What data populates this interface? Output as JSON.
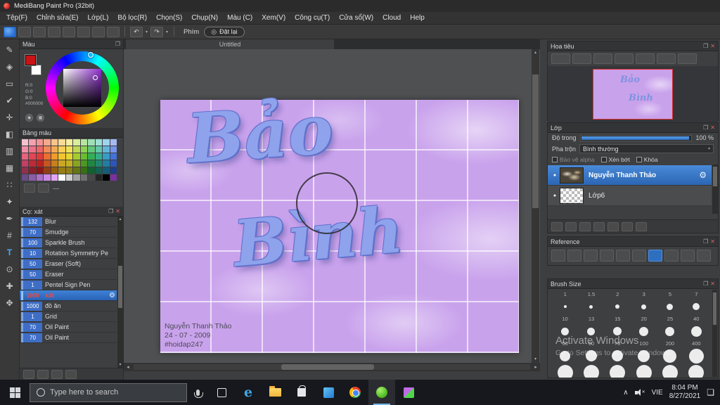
{
  "window": {
    "title": "MediBang Paint Pro (32bit)",
    "controls": [
      {
        "name": "minimize-button",
        "glyph": "–"
      },
      {
        "name": "maximize-button",
        "glyph": "▢"
      },
      {
        "name": "close-button",
        "glyph": "✕"
      }
    ]
  },
  "menu": {
    "items": [
      "Tệp(F)",
      "Chỉnh sửa(E)",
      "Lớp(L)",
      "Bộ lọc(R)",
      "Chọn(S)",
      "Chụp(N)",
      "Màu (C)",
      "Xem(V)",
      "Công cụ(T)",
      "Cửa sổ(W)",
      "Cloud",
      "Help"
    ]
  },
  "toolbar": {
    "icons": [
      {
        "name": "paint-tool-logo-icon",
        "glyph": "◉"
      },
      {
        "name": "save-icon",
        "glyph": "▤"
      },
      {
        "name": "comment-icon",
        "glyph": "❏"
      },
      {
        "name": "new-doc-icon",
        "glyph": "▢"
      },
      {
        "name": "copy-doc-icon",
        "glyph": "⊡"
      },
      {
        "name": "grid-view-icon",
        "glyph": "▦"
      },
      {
        "name": "panel-grid-icon",
        "glyph": "▥"
      },
      {
        "name": "layout-icon",
        "glyph": "☰"
      }
    ],
    "undo_glyph": "↶",
    "redo_glyph": "↷",
    "caret_glyph": "▾",
    "phim_label": "Phím",
    "reset_icon_glyph": "◎",
    "reset_label": "Đặt lại"
  },
  "chrome": {
    "float": "❐",
    "close": "✕",
    "up": "▴",
    "down": "▾",
    "left": "◂",
    "right": "▸"
  },
  "tools": {
    "items": [
      {
        "name": "brush-tool",
        "glyph": "✎"
      },
      {
        "name": "eraser-tool",
        "glyph": "◈"
      },
      {
        "name": "select-rect-tool",
        "glyph": "▭"
      },
      {
        "name": "select-pen-tool",
        "glyph": "✔"
      },
      {
        "name": "move-tool",
        "glyph": "✛"
      },
      {
        "name": "bucket-tool",
        "glyph": "◧"
      },
      {
        "name": "gradient-tool",
        "glyph": "▥"
      },
      {
        "name": "pattern-tool",
        "glyph": "▦"
      },
      {
        "name": "halftone-tool",
        "glyph": "∷"
      },
      {
        "name": "magic-wand-tool",
        "glyph": "✦"
      },
      {
        "name": "eyedropper-tool",
        "glyph": "✒"
      },
      {
        "name": "divide-tool",
        "glyph": "#"
      },
      {
        "name": "text-tool",
        "glyph": "T",
        "selected": true
      },
      {
        "name": "zoom-tool",
        "glyph": "⊙"
      },
      {
        "name": "measure-tool",
        "glyph": "✚"
      },
      {
        "name": "hand-tool",
        "glyph": "✥"
      }
    ]
  },
  "color_panel": {
    "title": "Màu",
    "rgb_lines": [
      "R:0",
      "G:0",
      "B:0",
      "#000000"
    ],
    "palette_title": "Bảng màu",
    "palette_placeholder": "---",
    "palette": [
      "#f6c2cc",
      "#f2a2b0",
      "#f29494",
      "#f4aa8a",
      "#f8c48c",
      "#fada96",
      "#f4ee9e",
      "#d8ee9c",
      "#b6e69e",
      "#9ee0b6",
      "#9ee0d6",
      "#9ed4ee",
      "#a6baf2",
      "#ee8ea6",
      "#ec7288",
      "#ec6666",
      "#f08c5a",
      "#f4aa54",
      "#f8ce56",
      "#f0e056",
      "#bed856",
      "#8ed056",
      "#64c67c",
      "#64c6aa",
      "#64b4da",
      "#7694ea",
      "#e6627e",
      "#e24656",
      "#e23a3a",
      "#e87032",
      "#ee9c2a",
      "#f2c42e",
      "#e6d62e",
      "#a4cc2e",
      "#68be2e",
      "#34ae56",
      "#34ae8a",
      "#349ec6",
      "#4272da",
      "#c24064",
      "#be2a3a",
      "#be2020",
      "#c45620",
      "#c8801c",
      "#cca620",
      "#c4b020",
      "#88a420",
      "#4c9820",
      "#208644",
      "#208670",
      "#207ea4",
      "#2e54b6",
      "#90304c",
      "#8c1e2a",
      "#8c1616",
      "#903e14",
      "#945e12",
      "#987c14",
      "#908014",
      "#647614",
      "#386e14",
      "#146032",
      "#146052",
      "#145c78",
      "#203c86",
      "#6a4c88",
      "#8c5ca8",
      "#ac70c8",
      "#ca88e4",
      "#e2a4f4",
      "#ffffff",
      "#d0d0d0",
      "#a0a0a0",
      "#707070",
      "#484848",
      "#242424",
      "#000000",
      "#7c30a2"
    ],
    "palette_tools": [
      {
        "name": "add-color-icon",
        "glyph": "⊞"
      },
      {
        "name": "delete-color-icon",
        "glyph": "⊟"
      }
    ]
  },
  "brush_panel": {
    "title": "Cọ: xát",
    "brushes": [
      {
        "size": "132",
        "name": "Blur"
      },
      {
        "size": "70",
        "name": "Smudge"
      },
      {
        "size": "100",
        "name": "Sparkle Brush"
      },
      {
        "size": "10",
        "name": "Rotation Symmetry Pe"
      },
      {
        "size": "50",
        "name": "Eraser (Soft)"
      },
      {
        "size": "50",
        "name": "Eraser"
      },
      {
        "size": "1",
        "name": "Pentel Sign Pen"
      },
      {
        "size": "1000",
        "name": "xát",
        "selected": true
      },
      {
        "size": "1000",
        "name": "đồ ăn"
      },
      {
        "size": "1",
        "name": "Grid"
      },
      {
        "size": "70",
        "name": "Oil Paint"
      },
      {
        "size": "70",
        "name": "Oil Paint"
      }
    ],
    "gear_glyph": "⚙",
    "tools": [
      {
        "name": "new-brush-icon",
        "glyph": "⊞"
      },
      {
        "name": "delete-brush-icon",
        "glyph": "⊟"
      },
      {
        "name": "brush-folder-icon",
        "glyph": "▤"
      },
      {
        "name": "brush-menu-icon",
        "glyph": "⊡"
      }
    ]
  },
  "canvas": {
    "tab": "Untitled",
    "word1": "Bảo",
    "word2": "Bình",
    "credits": [
      "Nguyễn Thanh Thảo",
      "24 - 07 - 2009",
      "#hoidap247"
    ]
  },
  "navigator": {
    "title": "Hoa tiêu",
    "icons": [
      {
        "name": "zoom-out-icon",
        "glyph": "⊖"
      },
      {
        "name": "zoom-in-icon",
        "glyph": "⊕"
      },
      {
        "name": "fit-window-icon",
        "glyph": "▢"
      },
      {
        "name": "actual-pixels-icon",
        "glyph": "▣"
      },
      {
        "name": "rotate-left-icon",
        "glyph": "↺"
      },
      {
        "name": "rotate-right-icon",
        "glyph": "↻"
      },
      {
        "name": "reset-rotation-icon",
        "glyph": "◎"
      }
    ]
  },
  "layer_panel": {
    "title": "Lớp",
    "opacity_label": "Độ trong",
    "opacity_value": "100 %",
    "blend_label": "Pha trộn",
    "blend_value": "Bình thường",
    "checkboxes": [
      {
        "label": "Bảo vệ alpha",
        "disabled": true
      },
      {
        "label": "Xén bớt"
      },
      {
        "label": "Khóa"
      }
    ],
    "layers": [
      {
        "name": "Nguyễn Thanh Thảo",
        "selected": true,
        "thumb": "art"
      },
      {
        "name": "Lớp6",
        "thumb": "checker"
      }
    ],
    "gear_glyph": "⚙",
    "eye_glyph": "●",
    "toolbar_icons": [
      {
        "name": "new-layer-icon",
        "glyph": "⊞"
      },
      {
        "name": "duplicate-layer-icon",
        "glyph": "⊡"
      },
      {
        "name": "transfer-layer-icon",
        "glyph": "▼"
      },
      {
        "name": "layer-folder-icon",
        "glyph": "▤"
      },
      {
        "name": "layer-order-icon",
        "glyph": "↕"
      },
      {
        "name": "layer-menu-icon",
        "glyph": "≡"
      },
      {
        "name": "delete-layer-icon",
        "glyph": "⊠"
      }
    ]
  },
  "reference_panel": {
    "title": "Reference",
    "icons": [
      {
        "name": "home-icon",
        "glyph": "⌂"
      },
      {
        "name": "image-icon",
        "glyph": "▦"
      },
      {
        "name": "clear-icon",
        "glyph": "✕"
      },
      {
        "name": "zoom-in-icon",
        "glyph": "⊕"
      },
      {
        "name": "zoom-out-icon",
        "glyph": "⊖"
      },
      {
        "name": "pencil-icon",
        "glyph": "✎"
      },
      {
        "name": "hand-icon",
        "glyph": "✥",
        "selected": true
      },
      {
        "name": "eyedropper-icon",
        "glyph": "✒"
      },
      {
        "name": "loupe-icon",
        "glyph": "⊙"
      },
      {
        "name": "panel-icon",
        "glyph": "▣"
      }
    ]
  },
  "brush_size_panel": {
    "title": "Brush Size",
    "rows": [
      [
        "1",
        "1.5",
        "2",
        "3",
        "5",
        "7"
      ],
      [
        "10",
        "13",
        "15",
        "20",
        "25",
        "40"
      ],
      [
        "50",
        "60",
        "70",
        "100",
        "200",
        "400"
      ]
    ]
  },
  "watermark": {
    "line1": "Activate Windows",
    "line2": "Go to Settings to activate Windows."
  },
  "taskbar": {
    "search_placeholder": "Type here to search",
    "apps": [
      {
        "name": "task-view-icon"
      },
      {
        "name": "edge-icon",
        "glyph": "e"
      },
      {
        "name": "file-explorer-icon"
      },
      {
        "name": "store-icon"
      },
      {
        "name": "photos-icon"
      },
      {
        "name": "chrome-icon"
      },
      {
        "name": "medibang-icon",
        "selected": true
      },
      {
        "name": "design-app-icon"
      }
    ],
    "tray": {
      "caret": "∧",
      "language": "VIE",
      "time": "8:04 PM",
      "date": "8/27/2021",
      "notif_glyph": "❏"
    }
  }
}
